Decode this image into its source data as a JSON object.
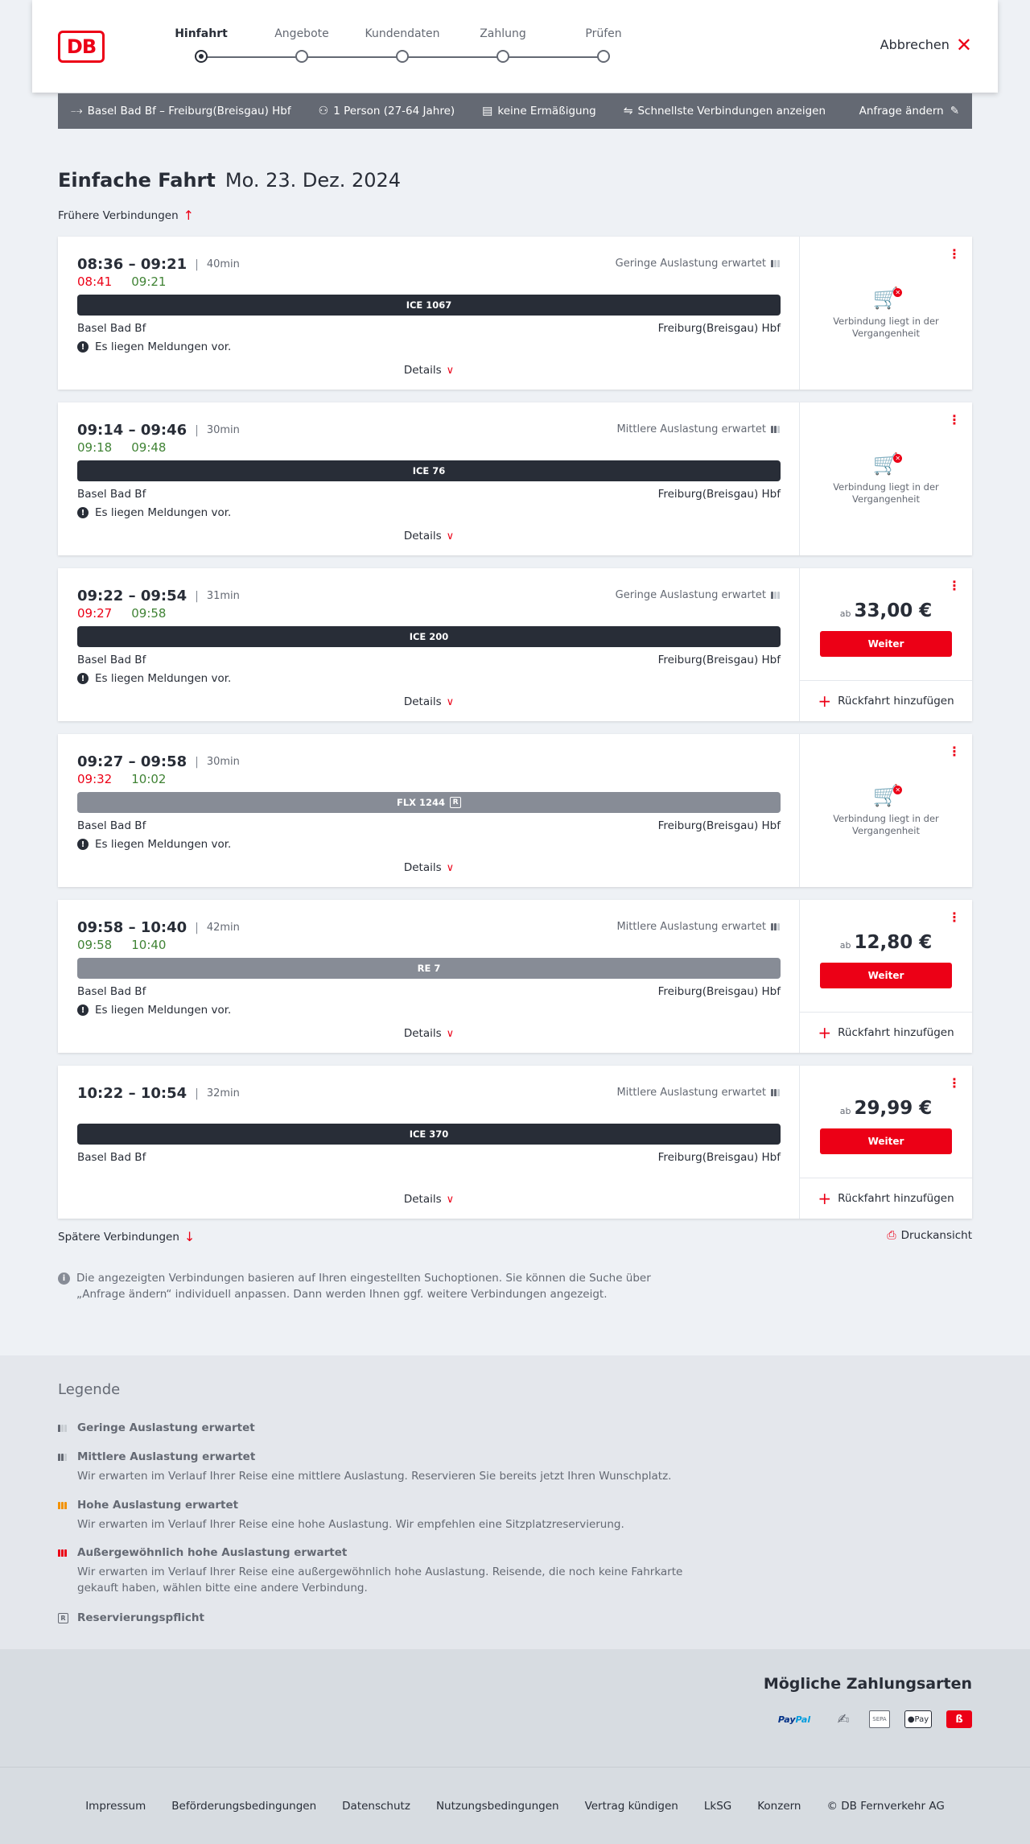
{
  "header": {
    "logo_text": "DB",
    "steps": [
      {
        "label": "Hinfahrt",
        "active": true
      },
      {
        "label": "Angebote",
        "active": false
      },
      {
        "label": "Kundendaten",
        "active": false
      },
      {
        "label": "Zahlung",
        "active": false
      },
      {
        "label": "Prüfen",
        "active": false
      }
    ],
    "cancel_label": "Abbrechen"
  },
  "searchbar": {
    "route": "Basel Bad Bf – Freiburg(Breisgau) Hbf",
    "travelers": "1 Person (27-64 Jahre)",
    "discount": "keine Ermäßigung",
    "option": "Schnellste Verbindungen anzeigen",
    "edit_label": "Anfrage ändern"
  },
  "page": {
    "title": "Einfache Fahrt",
    "date": "Mo. 23. Dez. 2024",
    "earlier_label": "Frühere Verbindungen",
    "later_label": "Spätere Verbindungen",
    "print_label": "Druckansicht",
    "info_text": "Die angezeigten Verbindungen basieren auf Ihren eingestellten Suchoptionen. Sie können die Suche über „Anfrage ändern“ individuell anpassen. Dann werden Ihnen ggf. weitere Verbindungen angezeigt.",
    "details_label": "Details",
    "return_label": "Rückfahrt hinzufügen",
    "weiter_label": "Weiter",
    "price_prefix": "ab",
    "past_label": "Verbindung liegt in der Vergangenheit"
  },
  "connections": [
    {
      "time": "08:36 – 09:21",
      "duration": "40min",
      "occupancy": "Geringe Auslastung erwartet",
      "occ_level": 1,
      "rt_dep": "08:41",
      "rt_dep_late": true,
      "rt_arr": "09:21",
      "rt_arr_late": false,
      "train": "ICE 1067",
      "train_grey": false,
      "reservation": false,
      "from": "Basel Bad Bf",
      "to": "Freiburg(Breisgau) Hbf",
      "notice": "Es liegen Meldungen vor.",
      "price": null
    },
    {
      "time": "09:14 – 09:46",
      "duration": "30min",
      "occupancy": "Mittlere Auslastung erwartet",
      "occ_level": 2,
      "rt_dep": "09:18",
      "rt_dep_late": false,
      "rt_arr": "09:48",
      "rt_arr_late": false,
      "train": "ICE 76",
      "train_grey": false,
      "reservation": false,
      "from": "Basel Bad Bf",
      "to": "Freiburg(Breisgau) Hbf",
      "notice": "Es liegen Meldungen vor.",
      "price": null
    },
    {
      "time": "09:22 – 09:54",
      "duration": "31min",
      "occupancy": "Geringe Auslastung erwartet",
      "occ_level": 1,
      "rt_dep": "09:27",
      "rt_dep_late": true,
      "rt_arr": "09:58",
      "rt_arr_late": false,
      "train": "ICE 200",
      "train_grey": false,
      "reservation": false,
      "from": "Basel Bad Bf",
      "to": "Freiburg(Breisgau) Hbf",
      "notice": "Es liegen Meldungen vor.",
      "price": "33,00 €"
    },
    {
      "time": "09:27 – 09:58",
      "duration": "30min",
      "occupancy": "",
      "occ_level": 0,
      "rt_dep": "09:32",
      "rt_dep_late": true,
      "rt_arr": "10:02",
      "rt_arr_late": false,
      "train": "FLX 1244",
      "train_grey": true,
      "reservation": true,
      "from": "Basel Bad Bf",
      "to": "Freiburg(Breisgau) Hbf",
      "notice": "Es liegen Meldungen vor.",
      "price": null
    },
    {
      "time": "09:58 – 10:40",
      "duration": "42min",
      "occupancy": "Mittlere Auslastung erwartet",
      "occ_level": 2,
      "rt_dep": "09:58",
      "rt_dep_late": false,
      "rt_arr": "10:40",
      "rt_arr_late": false,
      "train": "RE 7",
      "train_grey": true,
      "reservation": false,
      "from": "Basel Bad Bf",
      "to": "Freiburg(Breisgau) Hbf",
      "notice": "Es liegen Meldungen vor.",
      "price": "12,80 €"
    },
    {
      "time": "10:22 – 10:54",
      "duration": "32min",
      "occupancy": "Mittlere Auslastung erwartet",
      "occ_level": 2,
      "rt_dep": "",
      "rt_dep_late": false,
      "rt_arr": "",
      "rt_arr_late": false,
      "train": "ICE 370",
      "train_grey": false,
      "reservation": false,
      "from": "Basel Bad Bf",
      "to": "Freiburg(Breisgau) Hbf",
      "notice": "",
      "price": "29,99 €"
    }
  ],
  "legend": {
    "title": "Legende",
    "items": [
      {
        "title": "Geringe Auslastung erwartet",
        "desc": "",
        "icon": "occupancy-low-icon"
      },
      {
        "title": "Mittlere Auslastung erwartet",
        "desc": "Wir erwarten im Verlauf Ihrer Reise eine mittlere Auslastung. Reservieren Sie bereits jetzt Ihren Wunschplatz.",
        "icon": "occupancy-medium-icon"
      },
      {
        "title": "Hohe Auslastung erwartet",
        "desc": "Wir erwarten im Verlauf Ihrer Reise eine hohe Auslastung. Wir empfehlen eine Sitzplatzreservierung.",
        "icon": "occupancy-high-icon"
      },
      {
        "title": "Außergewöhnlich hohe Auslastung erwartet",
        "desc": "Wir erwarten im Verlauf Ihrer Reise eine außergewöhnlich hohe Auslastung. Reisende, die noch keine Fahrkarte gekauft haben, wählen bitte eine andere Verbindung.",
        "icon": "occupancy-very-high-icon"
      },
      {
        "title": "Reservierungspflicht",
        "desc": "",
        "icon": "reservation-required-icon"
      }
    ]
  },
  "payment": {
    "title": "Mögliche Zahlungsarten",
    "paypal_a": "Pay",
    "paypal_b": "Pal",
    "sepa": "SEPA",
    "apple_pay": "Pay",
    "db_pay": "ß"
  },
  "footer": {
    "links": [
      "Impressum",
      "Beförderungsbedingungen",
      "Datenschutz",
      "Nutzungsbedingungen",
      "Vertrag kündigen",
      "LkSG",
      "Konzern",
      "© DB Fernverkehr AG"
    ]
  },
  "colors": {
    "accent": "#ec0016",
    "late": "#ec0016",
    "on_time": "#408335",
    "train_dark": "#282d37",
    "train_grey": "#878c96"
  }
}
